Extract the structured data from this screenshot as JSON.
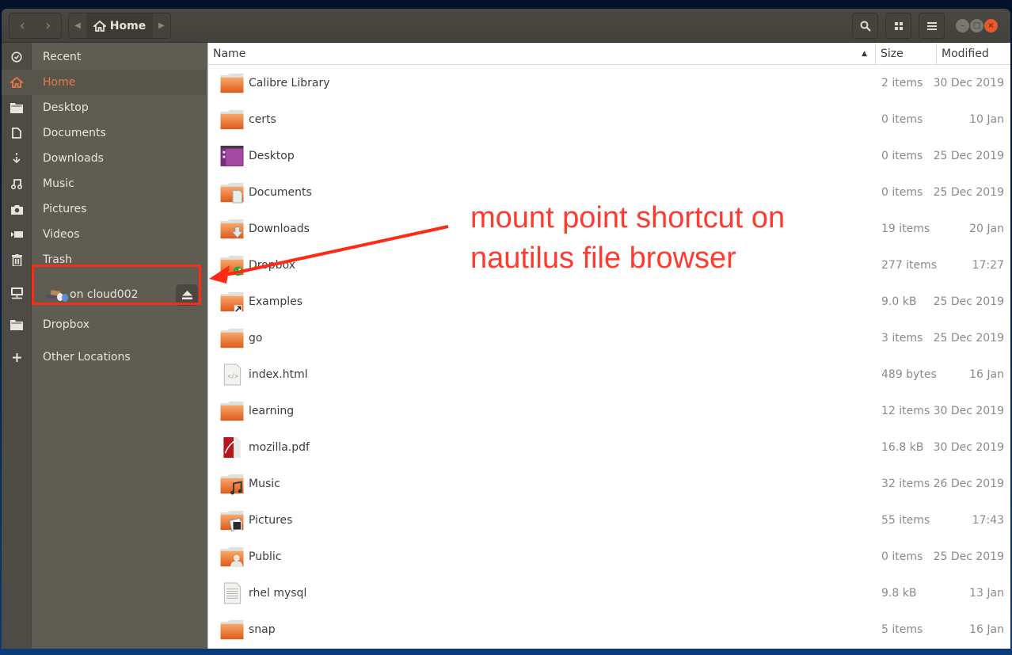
{
  "window": {
    "path": {
      "current": "Home",
      "icon": "home-icon"
    },
    "nav": {
      "back_icon": "chevron-left-icon",
      "forward_icon": "chevron-right-icon"
    },
    "toolbar": {
      "search_icon": "search-icon",
      "view_icon": "grid-view-icon",
      "menu_icon": "hamburger-menu-icon"
    },
    "controls": {
      "minimize": "–",
      "maximize": "□",
      "close": "×"
    }
  },
  "sidebar": {
    "items": [
      {
        "label": "Recent",
        "icon": "clock-icon",
        "active": false
      },
      {
        "label": "Home",
        "icon": "home-icon",
        "active": true
      },
      {
        "label": "Desktop",
        "icon": "folder-icon",
        "active": false
      },
      {
        "label": "Documents",
        "icon": "document-icon",
        "active": false
      },
      {
        "label": "Downloads",
        "icon": "download-icon",
        "active": false
      },
      {
        "label": "Music",
        "icon": "music-icon",
        "active": false
      },
      {
        "label": "Pictures",
        "icon": "camera-icon",
        "active": false
      },
      {
        "label": "Videos",
        "icon": "video-icon",
        "active": false
      },
      {
        "label": "Trash",
        "icon": "trash-icon",
        "active": false
      }
    ],
    "mount": {
      "label": "on cloud002",
      "icon": "network-drive-icon",
      "eject_icon": "eject-icon"
    },
    "dropbox": {
      "label": "Dropbox",
      "icon": "folder-icon"
    },
    "other": {
      "label": "Other Locations",
      "icon": "plus-icon"
    }
  },
  "columns": {
    "name": "Name",
    "size": "Size",
    "modified": "Modified",
    "sort": "ascending"
  },
  "files": [
    {
      "name": "Calibre Library",
      "size": "2 items",
      "modified": "30 Dec 2019",
      "type": "folder"
    },
    {
      "name": "certs",
      "size": "0 items",
      "modified": "10 Jan",
      "type": "folder"
    },
    {
      "name": "Desktop",
      "size": "0 items",
      "modified": "25 Dec 2019",
      "type": "desktop"
    },
    {
      "name": "Documents",
      "size": "0 items",
      "modified": "25 Dec 2019",
      "type": "folder-documents"
    },
    {
      "name": "Downloads",
      "size": "19 items",
      "modified": "20 Jan",
      "type": "folder-downloads"
    },
    {
      "name": "Dropbox",
      "size": "277 items",
      "modified": "17:27",
      "type": "folder-dropbox"
    },
    {
      "name": "Examples",
      "size": "9.0 kB",
      "modified": "25 Dec 2019",
      "type": "folder-link"
    },
    {
      "name": "go",
      "size": "3 items",
      "modified": "25 Dec 2019",
      "type": "folder"
    },
    {
      "name": "index.html",
      "size": "489 bytes",
      "modified": "16 Jan",
      "type": "html"
    },
    {
      "name": "learning",
      "size": "12 items",
      "modified": "30 Dec 2019",
      "type": "folder"
    },
    {
      "name": "mozilla.pdf",
      "size": "16.8 kB",
      "modified": "30 Dec 2019",
      "type": "pdf"
    },
    {
      "name": "Music",
      "size": "32 items",
      "modified": "26 Dec 2019",
      "type": "folder-music"
    },
    {
      "name": "Pictures",
      "size": "55 items",
      "modified": "17:43",
      "type": "folder-pictures"
    },
    {
      "name": "Public",
      "size": "0 items",
      "modified": "25 Dec 2019",
      "type": "folder-public"
    },
    {
      "name": "rhel mysql",
      "size": "9.8 kB",
      "modified": "13 Jan",
      "type": "text"
    },
    {
      "name": "snap",
      "size": "5 items",
      "modified": "16 Jan",
      "type": "folder"
    }
  ],
  "annotation": {
    "line1": "mount point shortcut on",
    "line2": "nautilus file browser",
    "color": "#ff3b2f"
  },
  "colors": {
    "accent": "#ed7646",
    "highlight": "#ff2a13",
    "sidebar": "#5f5c52",
    "headerbar": "#45433d"
  }
}
